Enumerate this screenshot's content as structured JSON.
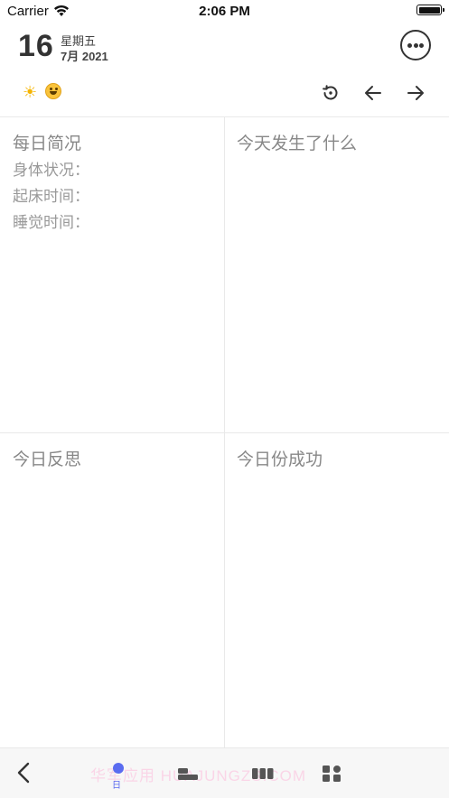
{
  "status_bar": {
    "carrier": "Carrier",
    "time": "2:06 PM"
  },
  "header": {
    "day": "16",
    "weekday": "星期五",
    "month_year": "7月 2021"
  },
  "toolbar": {
    "weather_icon": "sun-icon",
    "mood_icon": "smile-icon"
  },
  "quadrants": {
    "daily_summary": {
      "title": "每日简况",
      "fields": [
        "身体状况：",
        "起床时间：",
        "睡觉时间："
      ]
    },
    "what_happened": {
      "title": "今天发生了什么"
    },
    "reflection": {
      "title": "今日反思"
    },
    "success": {
      "title": "今日份成功"
    }
  },
  "tabbar": {
    "active_tab_label": "日"
  },
  "watermark": "华军应用 HUAJUNGZS.COM",
  "colors": {
    "accent": "#5a6cf0",
    "text_muted": "#888888",
    "sun": "#f5b400"
  }
}
